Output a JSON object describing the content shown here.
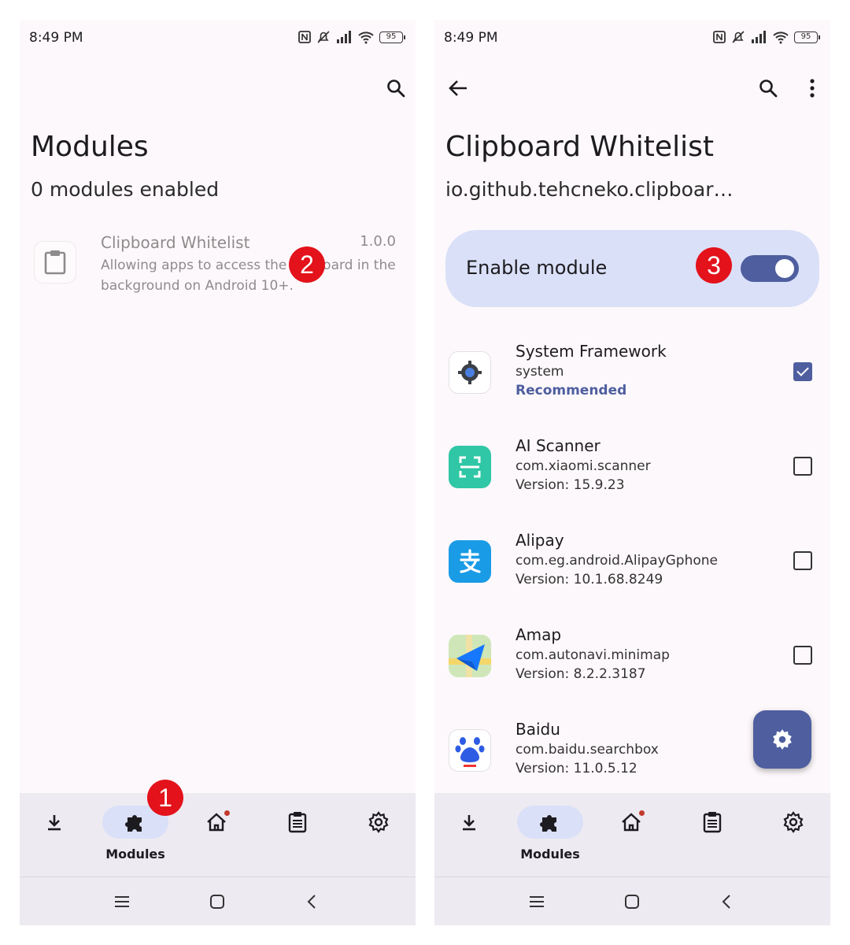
{
  "status": {
    "time": "8:49 PM",
    "battery": "95"
  },
  "left": {
    "title": "Modules",
    "subtitle": "0 modules enabled",
    "module": {
      "name": "Clipboard Whitelist",
      "version": "1.0.0",
      "description": "Allowing apps to access the clipboard in the background on Android 10+."
    }
  },
  "right": {
    "title": "Clipboard Whitelist",
    "subtitle": "io.github.tehcneko.clipboar…",
    "enable_label": "Enable module",
    "enabled": true,
    "apps": [
      {
        "name": "System Framework",
        "pkg": "system",
        "extra": "Recommended",
        "checked": true,
        "icon": "gear-icon"
      },
      {
        "name": "AI Scanner",
        "pkg": "com.xiaomi.scanner",
        "extra": "Version: 15.9.23",
        "checked": false,
        "icon": "scanner-icon"
      },
      {
        "name": "Alipay",
        "pkg": "com.eg.android.AlipayGphone",
        "extra": "Version: 10.1.68.8249",
        "checked": false,
        "icon": "alipay-icon"
      },
      {
        "name": "Amap",
        "pkg": "com.autonavi.minimap",
        "extra": "Version: 8.2.2.3187",
        "checked": false,
        "icon": "amap-icon"
      },
      {
        "name": "Baidu",
        "pkg": "com.baidu.searchbox",
        "extra": "Version: 11.0.5.12",
        "checked": false,
        "icon": "baidu-icon"
      }
    ]
  },
  "nav": {
    "modules_label": "Modules"
  },
  "badges": {
    "one": "1",
    "two": "2",
    "three": "3"
  },
  "colors": {
    "accent": "#4e5e9f",
    "badge": "#e3121b",
    "card": "#dae0f8"
  }
}
